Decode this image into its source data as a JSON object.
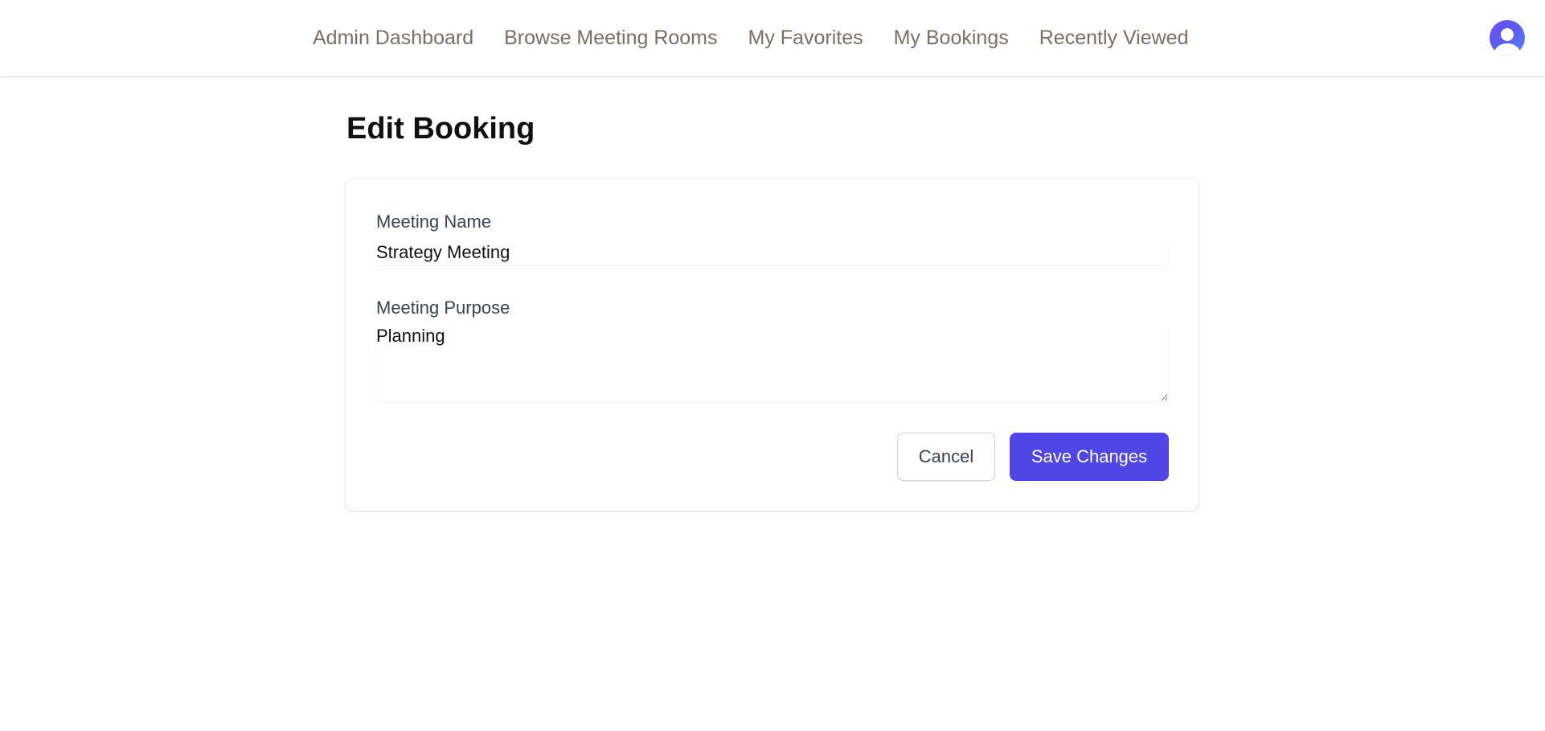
{
  "nav": {
    "items": [
      {
        "label": "Admin Dashboard"
      },
      {
        "label": "Browse Meeting Rooms"
      },
      {
        "label": "My Favorites"
      },
      {
        "label": "My Bookings"
      },
      {
        "label": "Recently Viewed"
      }
    ],
    "avatar_icon": "user-avatar-icon"
  },
  "page": {
    "title": "Edit Booking"
  },
  "form": {
    "meeting_name": {
      "label": "Meeting Name",
      "value": "Strategy Meeting"
    },
    "meeting_purpose": {
      "label": "Meeting Purpose",
      "value": "Planning"
    },
    "cancel_label": "Cancel",
    "save_label": "Save Changes"
  },
  "colors": {
    "accent": "#5046e5",
    "nav_text": "#7a6e66"
  }
}
